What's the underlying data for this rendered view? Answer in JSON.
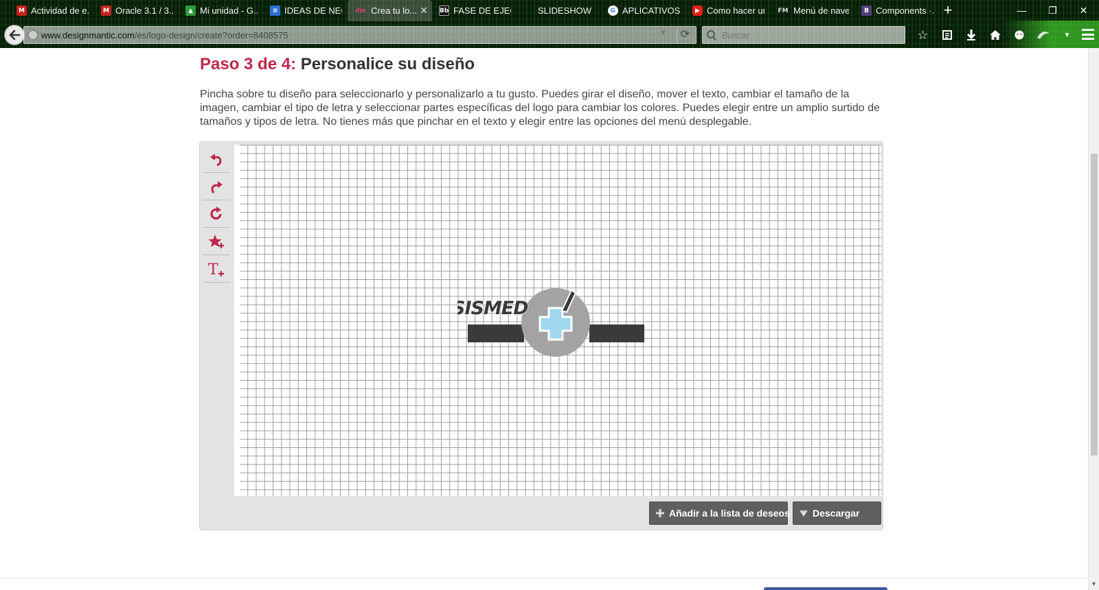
{
  "browser": {
    "tabs": [
      {
        "title": "Actividad de e...",
        "favicon": "gmail-icon",
        "color": "#c5221f",
        "glyph": "M",
        "active": false
      },
      {
        "title": "Oracle 3.1 / 3....",
        "favicon": "gmail-icon",
        "color": "#c5221f",
        "glyph": "M",
        "active": false
      },
      {
        "title": "Mi unidad - G...",
        "favicon": "google-drive-icon",
        "color": "#2a9d3a",
        "glyph": "▲",
        "active": false
      },
      {
        "title": "IDEAS DE NEG...",
        "favicon": "google-docs-icon",
        "color": "#2e6fd6",
        "glyph": "≡",
        "active": false
      },
      {
        "title": "Crea tu lo...",
        "favicon": "designmantic-icon",
        "color": "#c0264b",
        "glyph": "dm",
        "active": true
      },
      {
        "title": "FASE DE EJEC...",
        "favicon": "blackboard-icon",
        "color": "#111111",
        "glyph": "Bb",
        "active": false
      },
      {
        "title": "SLIDESHOW",
        "favicon": "blank-page-icon",
        "color": "#000000",
        "glyph": "",
        "active": false
      },
      {
        "title": "APLICATIVOS",
        "favicon": "google-icon",
        "color": "#ffffff",
        "glyph": "G",
        "active": false
      },
      {
        "title": "Como hacer un...",
        "favicon": "youtube-icon",
        "color": "#e62117",
        "glyph": "▶",
        "active": false
      },
      {
        "title": "Menú de nave...",
        "favicon": "fm-icon",
        "color": "#000000",
        "glyph": "FM",
        "active": false
      },
      {
        "title": "Components ·...",
        "favicon": "bootstrap-icon",
        "color": "#563d7c",
        "glyph": "B",
        "active": false
      }
    ],
    "url_host": "www.designmantic.com",
    "url_path": "/es/logo-design/create?order=8408575",
    "search_placeholder": "Buscar"
  },
  "page": {
    "step_label": "Paso 3 de 4:",
    "step_title": " Personalice su diseño",
    "description": "Pincha sobre tu diseño para seleccionarlo y personalizarlo a tu gusto. Puedes girar el diseño, mover el texto, cambiar el tamaño de la imagen, cambiar el tipo de letra y seleccionar partes específicas del logo para cambiar los colores. Puedes elegir entre un amplio surtido de tamaños y tipos de letra. No tienes más que pinchar en el texto y elegir entre las opciones del menú desplegable."
  },
  "editor": {
    "tools": [
      {
        "name": "undo-icon"
      },
      {
        "name": "redo-icon"
      },
      {
        "name": "rotate-icon"
      },
      {
        "name": "add-symbol-icon"
      },
      {
        "name": "add-text-icon"
      }
    ],
    "logo_text": "SISMED",
    "wishlist_label": "Añadir a la lista de deseos",
    "download_label": "Descargar"
  },
  "colors": {
    "accent": "#c0264b",
    "logo_dark": "#3a3a3a",
    "logo_gray": "#a3a3a3",
    "logo_cross": "#9fd8ee",
    "button_bg": "#5f5f5f"
  }
}
